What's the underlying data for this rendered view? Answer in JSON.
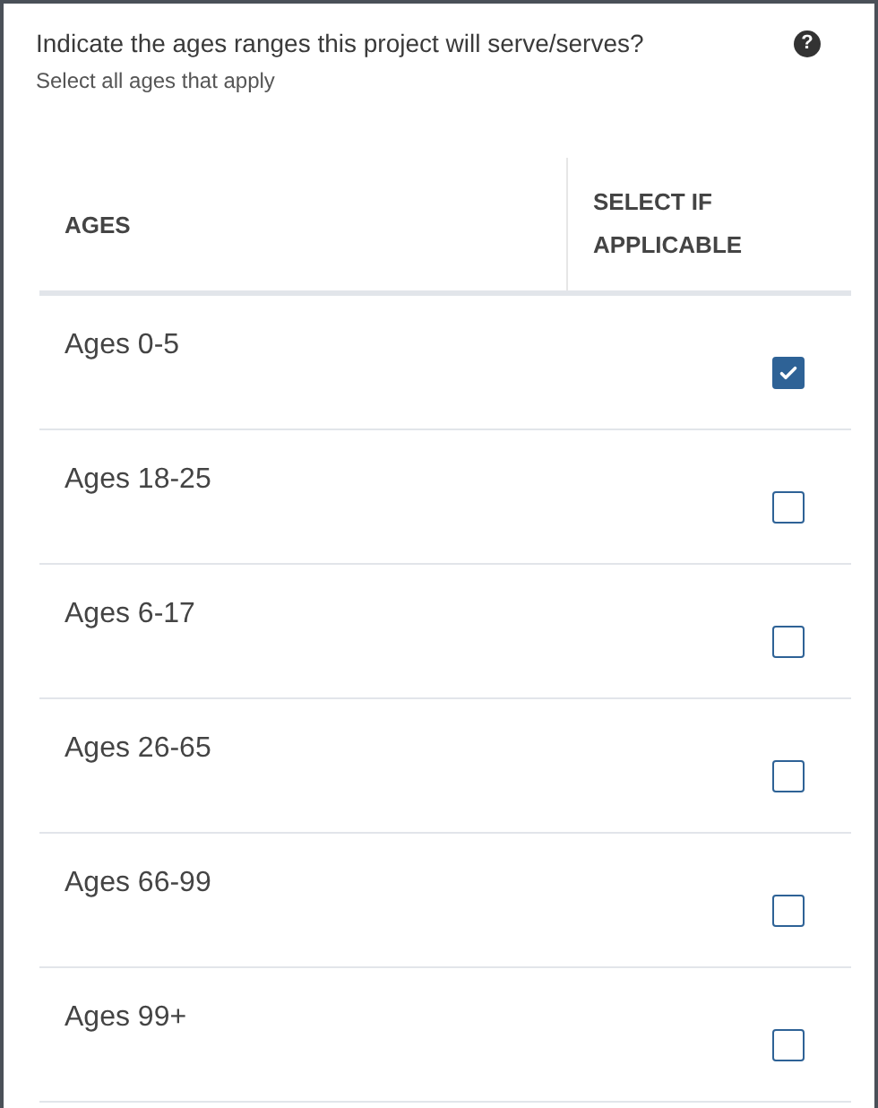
{
  "question": {
    "title": "Indicate the ages ranges this project will serve/serves?",
    "help_icon": "?",
    "subtitle": "Select all ages that apply"
  },
  "table": {
    "columns": [
      "AGES",
      "SELECT IF APPLICABLE"
    ],
    "rows": [
      {
        "label": "Ages 0-5",
        "checked": true
      },
      {
        "label": "Ages 18-25",
        "checked": false
      },
      {
        "label": "Ages 6-17",
        "checked": false
      },
      {
        "label": "Ages 26-65",
        "checked": false
      },
      {
        "label": "Ages 66-99",
        "checked": false
      },
      {
        "label": "Ages 99+",
        "checked": false
      }
    ]
  }
}
